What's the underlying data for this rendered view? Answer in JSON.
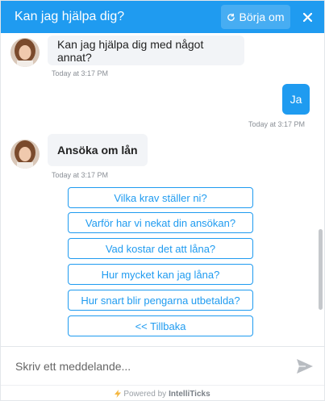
{
  "header": {
    "title": "Kan jag hjälpa dig?",
    "restart_label": "Börja om",
    "restart_icon": "refresh-icon",
    "close_icon": "close-icon",
    "color": "#1f9bf0"
  },
  "messages": [
    {
      "from": "bot",
      "text": "Kan jag hjälpa dig med något annat?",
      "time": "Today at 3:17 PM"
    },
    {
      "from": "user",
      "text": "Ja",
      "time": "Today at 3:17 PM"
    },
    {
      "from": "bot",
      "text": "Ansöka om lån",
      "time": "Today at 3:17 PM"
    }
  ],
  "options": [
    "Vilka krav ställer ni?",
    "Varför har vi nekat din ansökan?",
    "Vad kostar det att låna?",
    "Hur mycket kan jag låna?",
    "Hur snart blir pengarna utbetalda?",
    "<< Tillbaka"
  ],
  "composer": {
    "placeholder": "Skriv ett meddelande...",
    "send_icon": "send-icon"
  },
  "footer": {
    "prefix": "Powered by",
    "brand": "IntelliTicks",
    "icon": "lightning-icon"
  }
}
